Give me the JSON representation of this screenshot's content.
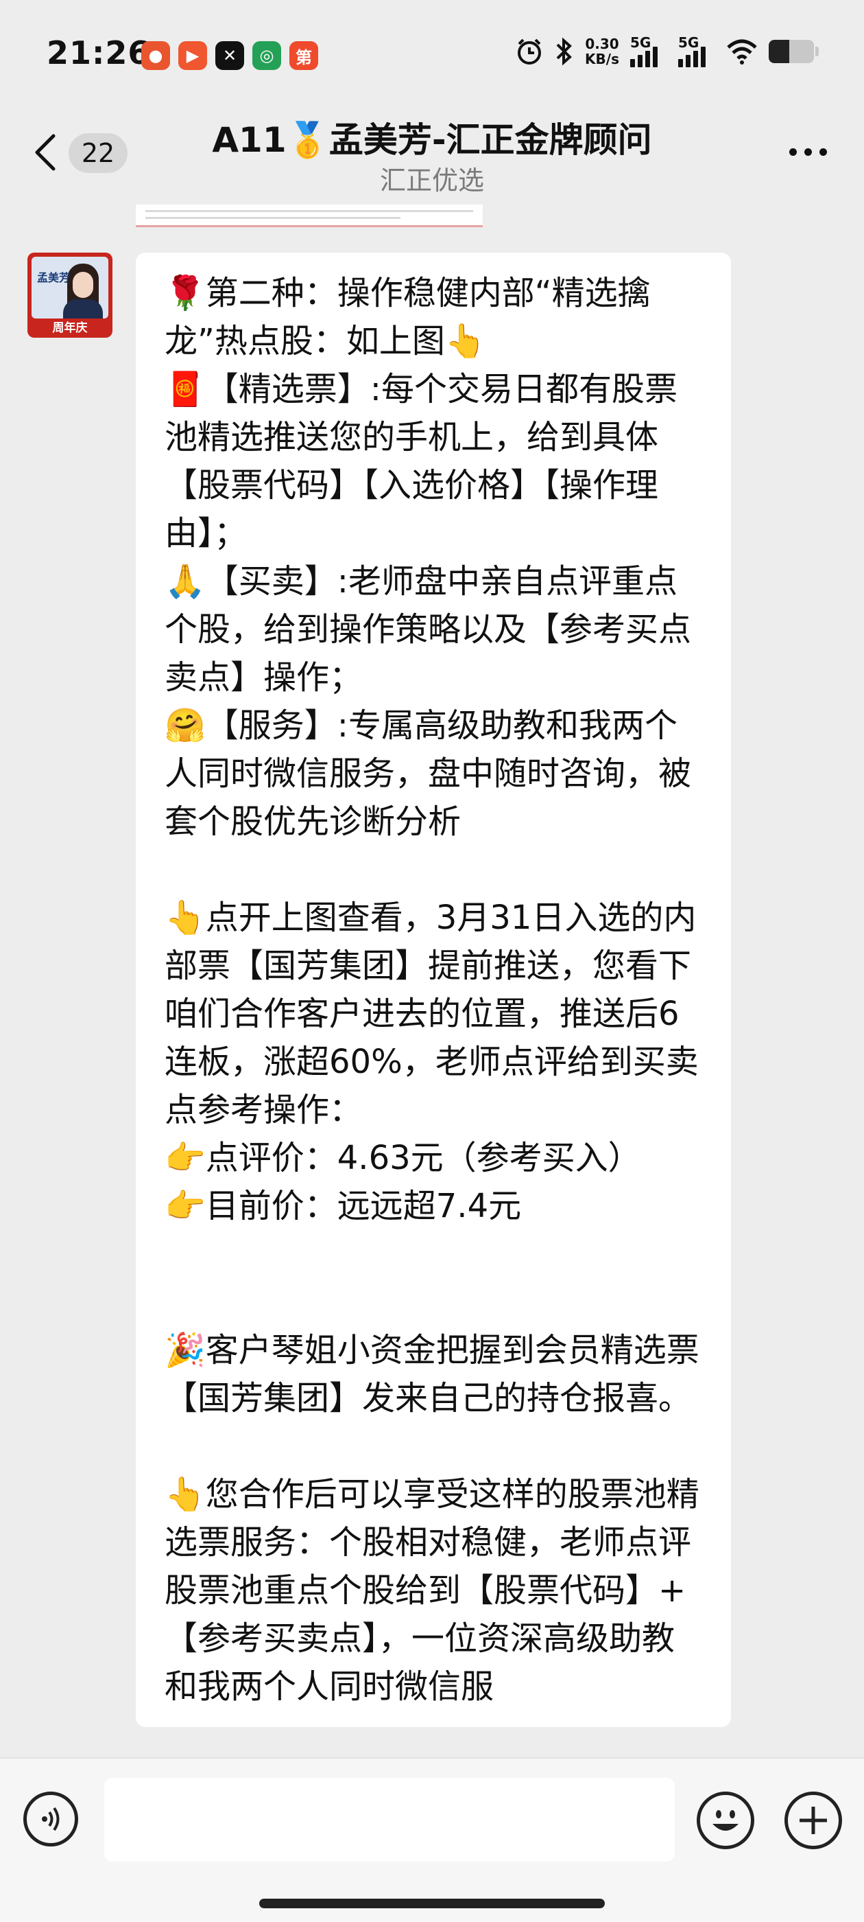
{
  "status_bar": {
    "time": "21:26",
    "net_speed_value": "0.30",
    "net_speed_unit": "KB/s",
    "signal_1_label": "5G",
    "signal_2_label": "5G",
    "battery_level": 0.45,
    "app_icons": [
      "shopping-app-icon",
      "video-app-icon",
      "capcut-icon",
      "bank-app-icon",
      "news-app-icon"
    ],
    "app_icon_glyphs": [
      "",
      "",
      "",
      "",
      "第"
    ]
  },
  "header": {
    "unread_count": "22",
    "title": "A11🥇孟美芳-汇正金牌顾问",
    "subtitle": "汇正优选"
  },
  "message": {
    "sender_avatar_name": "孟美芳",
    "avatar_badge": "周年庆",
    "text": "🌹第二种：操作稳健内部“精选擒龙”热点股：如上图👆\n🧧【精选票】:每个交易日都有股票池精选推送您的手机上，给到具体【股票代码】【入选价格】【操作理由】；\n🙏【买卖】:老师盘中亲自点评重点个股，给到操作策略以及【参考买点卖点】操作；\n🤗【服务】:专属高级助教和我两个人同时微信服务，盘中随时咨询，被套个股优先诊断分析\n\n👆点开上图查看，3月31日入选的内部票【国芳集团】提前推送，您看下咱们合作客户进去的位置，推送后6连板，涨超60%，老师点评给到买卖点参考操作：\n👉点评价：4.63元（参考买入）\n👉目前价：远远超7.4元\n\n\n🎉客户琴姐小资金把握到会员精选票【国芳集团】发来自己的持仓报喜。\n\n👆您合作后可以享受这样的股票池精选票服务：个股相对稳健，老师点评股票池重点个股给到【股票代码】+【参考买卖点】，一位资深高级助教和我两个人同时微信服"
  },
  "colors": {
    "background": "#ededed",
    "bubble": "#ffffff",
    "avatar_frame": "#c8251e"
  }
}
